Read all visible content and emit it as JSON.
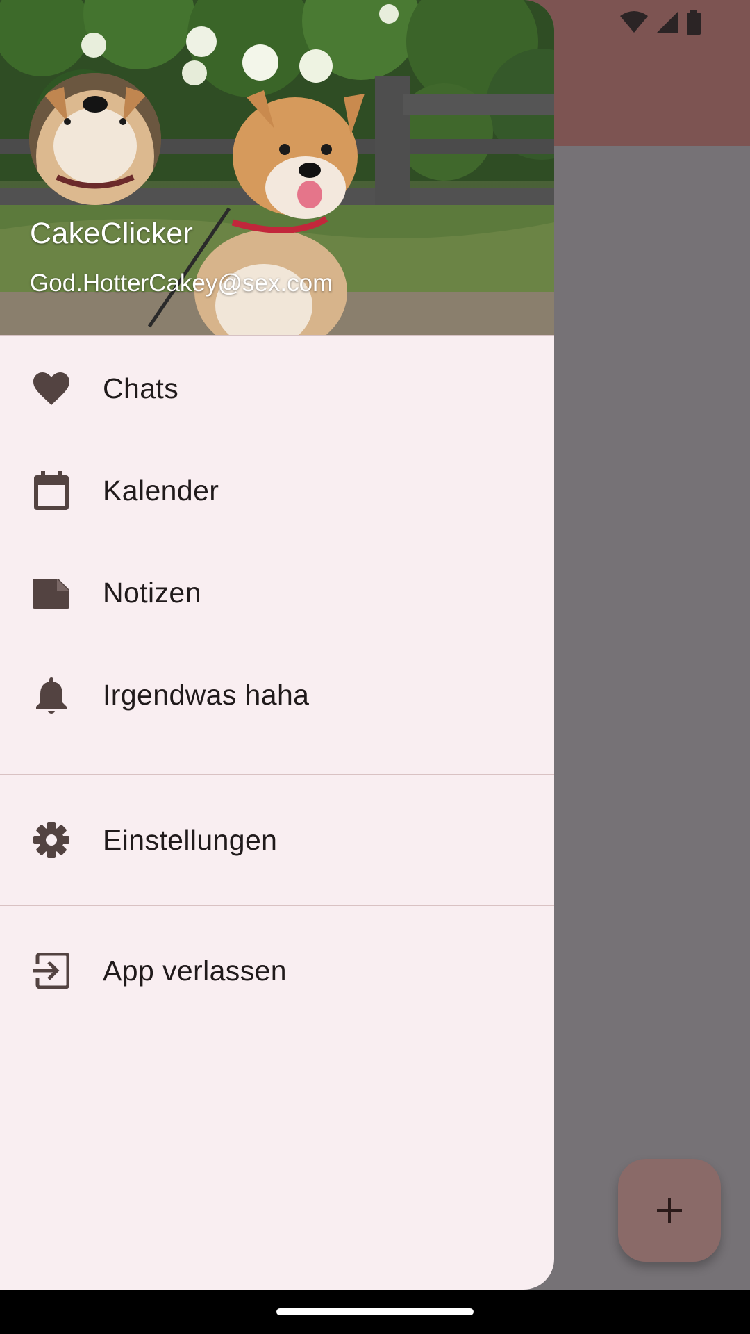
{
  "user": {
    "name": "CakeClicker",
    "email": "God.HotterCakey@sex.com"
  },
  "menu": {
    "items": [
      {
        "label": "Chats",
        "icon": "heart-icon"
      },
      {
        "label": "Kalender",
        "icon": "calendar-icon"
      },
      {
        "label": "Notizen",
        "icon": "note-icon"
      },
      {
        "label": "Irgendwas haha",
        "icon": "bell-icon"
      }
    ],
    "settings": {
      "label": "Einstellungen",
      "icon": "gear-icon"
    },
    "exit": {
      "label": "App verlassen",
      "icon": "exit-icon"
    }
  },
  "fab": {
    "icon": "plus-icon"
  },
  "colors": {
    "drawer_bg": "#f9eef1",
    "icon": "#534341",
    "app_bar": "#7d5452",
    "scrim_bg": "#767276"
  }
}
